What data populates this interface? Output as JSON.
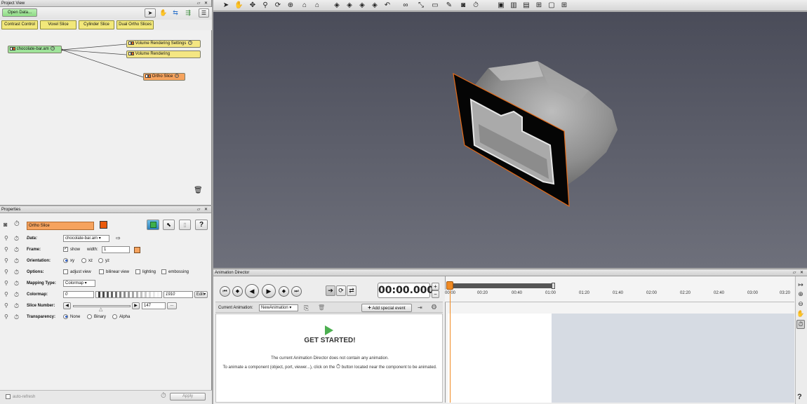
{
  "project_view": {
    "title": "Project View",
    "window_controls": "▱ ✕",
    "open_data_label": "Open Data...",
    "quick_buttons": [
      "Contrast Control",
      "Voxel Slice",
      "Cylinder Slice",
      "Dual Ortho Slices"
    ],
    "data_node": "chocolate-bar.am",
    "modules": [
      "Volume Rendering Settings",
      "Volume Rendering",
      "Ortho Slice"
    ],
    "toolbar_icons": [
      "pointer-icon",
      "hand-icon",
      "connect-icon",
      "layout-icon",
      "tree-view-icon"
    ]
  },
  "properties": {
    "title": "Properties",
    "window_controls": "▱ ✕",
    "module_name": "Ortho Slice",
    "module_color": "#ea5a0c",
    "rows": {
      "data_label": "Data:",
      "data_value": "chocolate-bar.am",
      "frame_label": "Frame:",
      "frame_show": "show",
      "frame_width_label": "width:",
      "frame_width": "1",
      "orientation_label": "Orientation:",
      "orientation_options": [
        "xy",
        "xz",
        "yz"
      ],
      "options_label": "Options:",
      "options_checks": [
        "adjust view",
        "bilinear view",
        "lighting",
        "embossing"
      ],
      "mapping_label": "Mapping Type:",
      "mapping_value": "Colormap",
      "colormap_label": "Colormap:",
      "colormap_min": "0",
      "colormap_max": "1910",
      "colormap_edit": "Edit",
      "slice_label": "Slice Number:",
      "slice_value": "147",
      "slice_more": "...",
      "transparency_label": "Transparency:",
      "transparency_options": [
        "None",
        "Binary",
        "Alpha"
      ]
    },
    "auto_refresh": "auto-refresh",
    "apply": "Apply"
  },
  "animation_director": {
    "title": "Animation Director",
    "window_controls": "▱ ✕",
    "time": "00:00.000",
    "current_animation_label": "Current Animation:",
    "current_animation_value": "NewAnimation",
    "add_event": "Add special event",
    "get_started": "GET STARTED!",
    "message_line1": "The current Animation Director does not contain any animation.",
    "message_line2a": "To animate a component (object, port, viewer...), click on the",
    "message_line2b": "button located near the component to be animated.",
    "timeline_ticks": [
      "00:00",
      "00:20",
      "00:40",
      "01:00",
      "01:20",
      "01:40",
      "02:00",
      "02:20",
      "02:40",
      "03:00",
      "03:20"
    ]
  },
  "viewer": {
    "background_top": "#4a4c59",
    "background_bottom": "#6e707b",
    "help_label": "?"
  }
}
